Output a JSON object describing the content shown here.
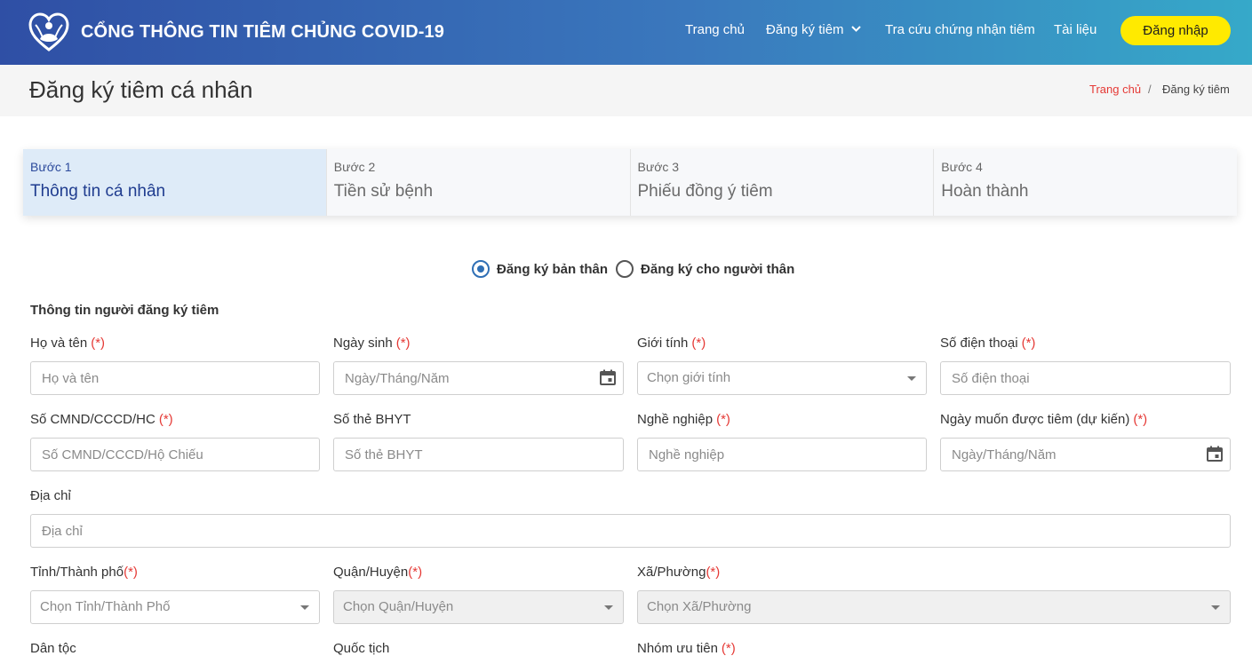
{
  "header": {
    "brand": "CỔNG THÔNG TIN TIÊM CHỦNG COVID-19",
    "nav": [
      "Trang chủ",
      "Đăng ký tiêm",
      "Tra cứu chứng nhận tiêm",
      "Tài liệu"
    ],
    "login": "Đăng nhập",
    "colors": {
      "gradient_start": "#2f4fa5",
      "gradient_end": "#36a9c9",
      "login_bg": "#ffea00"
    }
  },
  "page": {
    "title": "Đăng ký tiêm cá nhân",
    "breadcrumb": {
      "home": "Trang chủ",
      "separator": "/",
      "current": "Đăng ký tiêm"
    }
  },
  "steps": [
    {
      "num": "Bước 1",
      "name": "Thông tin cá nhân",
      "active": true
    },
    {
      "num": "Bước 2",
      "name": "Tiền sử bệnh",
      "active": false
    },
    {
      "num": "Bước 3",
      "name": "Phiếu đồng ý tiêm",
      "active": false
    },
    {
      "num": "Bước 4",
      "name": "Hoàn thành",
      "active": false
    }
  ],
  "registration_type": {
    "self": "Đăng ký bản thân",
    "relative": "Đăng ký cho người thân",
    "selected": "self"
  },
  "form": {
    "section_title": "Thông tin người đăng ký tiêm",
    "required_mark": "(*)",
    "fields": {
      "fullname": {
        "label": "Họ và tên",
        "placeholder": "Họ và tên"
      },
      "dob": {
        "label": "Ngày sinh",
        "placeholder": "Ngày/Tháng/Năm"
      },
      "gender": {
        "label": "Giới tính",
        "placeholder": "Chọn giới tính"
      },
      "phone": {
        "label": "Số điện thoại",
        "placeholder": "Số điện thoại"
      },
      "id_number": {
        "label": "Số CMND/CCCD/HC",
        "placeholder": "Số CMND/CCCD/Hộ Chiếu"
      },
      "insurance": {
        "label": "Số thẻ BHYT",
        "placeholder": "Số thẻ BHYT"
      },
      "occupation": {
        "label": "Nghề nghiệp",
        "placeholder": "Nghề nghiệp"
      },
      "desired_date": {
        "label": "Ngày muốn được tiêm (dự kiến)",
        "placeholder": "Ngày/Tháng/Năm"
      },
      "address": {
        "label": "Địa chỉ",
        "placeholder": "Địa chỉ"
      },
      "province": {
        "label": "Tỉnh/Thành phố",
        "placeholder": "Chọn Tỉnh/Thành Phố"
      },
      "district": {
        "label": "Quận/Huyện",
        "placeholder": "Chọn Quận/Huyện"
      },
      "ward": {
        "label": "Xã/Phường",
        "placeholder": "Chọn Xã/Phường"
      },
      "ethnicity": {
        "label": "Dân tộc"
      },
      "nationality": {
        "label": "Quốc tịch"
      },
      "priority_group": {
        "label": "Nhóm ưu tiên"
      }
    }
  }
}
